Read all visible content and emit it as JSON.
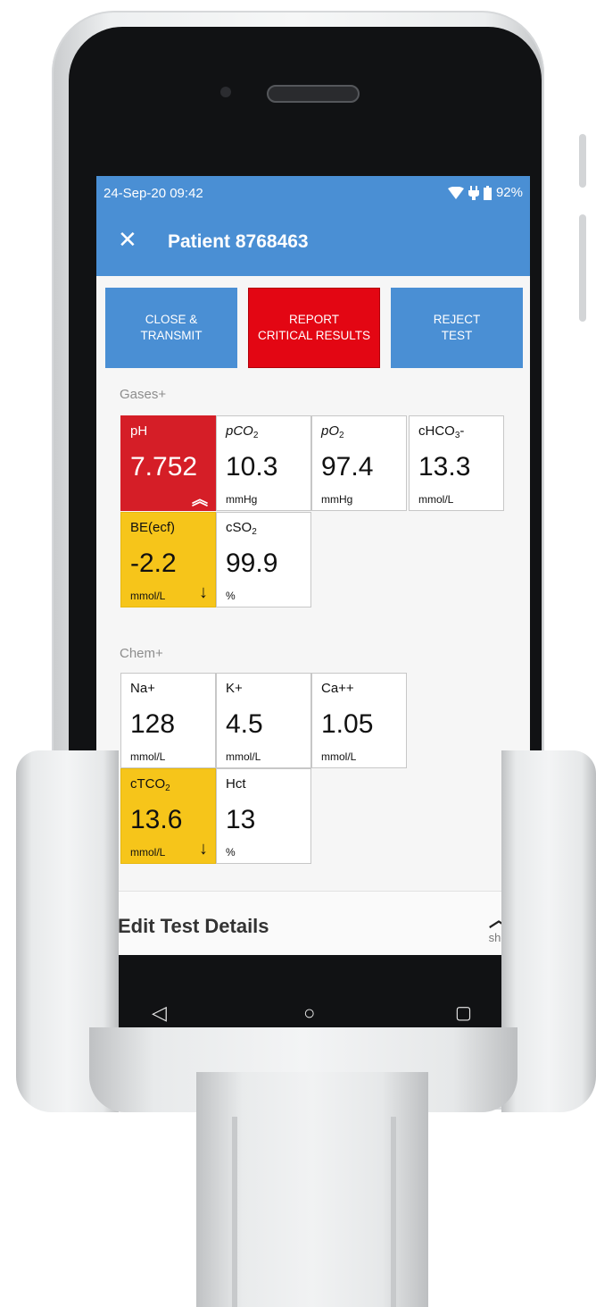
{
  "status": {
    "time": "24-Sep-20 09:42",
    "battery": "92%",
    "wifi_icon": "wifi-icon",
    "charging_icon": "plug-icon",
    "battery_icon": "battery-icon"
  },
  "header": {
    "close_icon": "close-icon",
    "title": "Patient 8768463"
  },
  "actions": [
    {
      "label": "CLOSE &\nTRANSMIT",
      "color": "#4a8fd4"
    },
    {
      "label": "REPORT\nCRITICAL RESULTS",
      "color": "#e30613"
    },
    {
      "label": "REJECT\nTEST",
      "color": "#4a8fd4"
    }
  ],
  "gases": {
    "label": "Gases+",
    "tiles": [
      {
        "name": "pH",
        "value": "7.752",
        "unit": "",
        "flag": "critical-high",
        "arrow": "double-up-chevron-icon"
      },
      {
        "name": "pCO",
        "sub": "2",
        "value": "10.3",
        "unit": "mmHg"
      },
      {
        "name": "pO",
        "sub": "2",
        "value": "97.4",
        "unit": "mmHg"
      },
      {
        "name": "cHCO",
        "sub": "3",
        "suffix": "-",
        "value": "13.3",
        "unit": "mmol/L"
      },
      {
        "name": "BE(ecf)",
        "value": "-2.2",
        "unit": "mmol/L",
        "flag": "low",
        "arrow": "down-arrow-icon"
      },
      {
        "name": "cSO",
        "sub": "2",
        "value": "99.9",
        "unit": "%"
      }
    ]
  },
  "chem": {
    "label": "Chem+",
    "tiles": [
      {
        "name": "Na+",
        "value": "128",
        "unit": "mmol/L"
      },
      {
        "name": "K+",
        "value": "4.5",
        "unit": "mmol/L"
      },
      {
        "name": "Ca++",
        "value": "1.05",
        "unit": "mmol/L"
      },
      {
        "name": "cTCO",
        "sub": "2",
        "value": "13.6",
        "unit": "mmol/L",
        "flag": "low",
        "arrow": "down-arrow-icon"
      },
      {
        "name": "Hct",
        "value": "13",
        "unit": "%"
      }
    ]
  },
  "edit_details": {
    "title": "Edit Test Details",
    "toggle_label": "show",
    "chevron_icon": "chevron-up-icon"
  },
  "navigation": {
    "back_icon": "back-triangle-icon",
    "home_icon": "home-circle-icon",
    "recents_icon": "recents-square-icon"
  },
  "colors": {
    "header": "#4a8fd4",
    "critical": "#d51e27",
    "warning": "#f6c51a"
  }
}
